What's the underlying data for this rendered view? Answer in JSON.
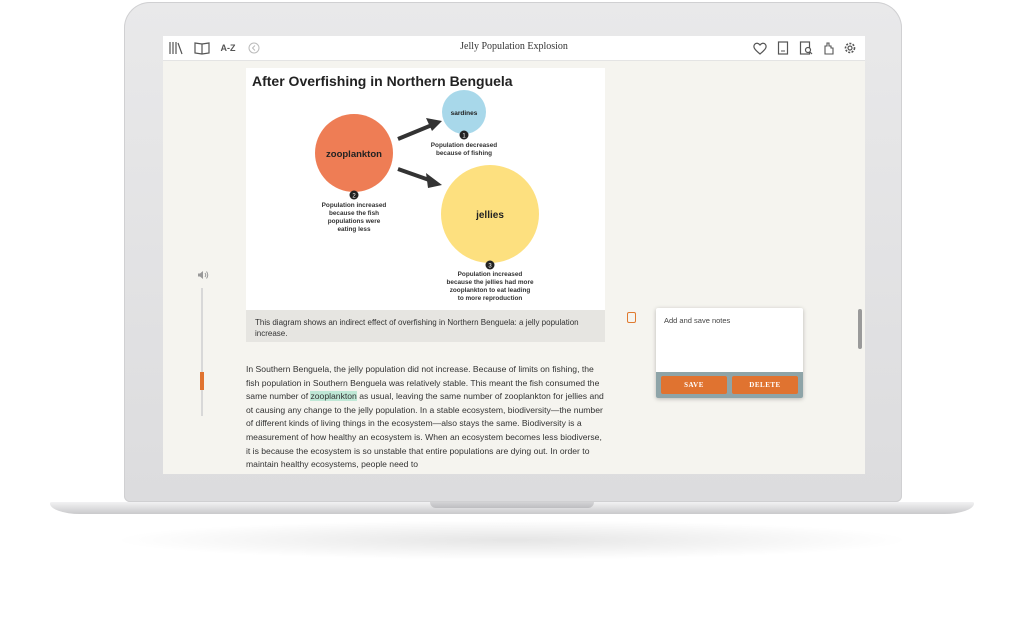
{
  "header": {
    "title": "Jelly Population Explosion",
    "icons_left": [
      "library-icon",
      "book-icon",
      "a-z-icon",
      "back-icon"
    ],
    "icons_right": [
      "heart-icon",
      "notebook-icon",
      "search-doc-icon",
      "hand-icon",
      "gear-icon"
    ],
    "az_label": "A-Z"
  },
  "diagram": {
    "title": "After Overfishing in Northern Benguela",
    "nodes": {
      "zooplankton": "zooplankton",
      "sardines": "sardines",
      "jellies": "jellies"
    },
    "steps": {
      "one": "1",
      "two": "2",
      "three": "3"
    },
    "notes": {
      "sardines": [
        "Population decreased",
        "because of fishing"
      ],
      "zooplankton": [
        "Population increased",
        "because the fish",
        "populations were",
        "eating less"
      ],
      "jellies": [
        "Population increased",
        "because the jellies had more",
        "zooplankton to eat leading",
        "to more reproduction"
      ]
    },
    "colors": {
      "zooplankton": "#ee7d55",
      "sardines": "#a8d8ea",
      "jellies": "#fde07f"
    }
  },
  "caption": "This diagram shows an indirect effect of overfishing in Northern Benguela: a jelly population increase.",
  "body": {
    "part1": "In Southern Benguela, the jelly population did not increase. Because of limits on fishing, the fish population in Southern Benguela was relatively stable. This meant the fish consumed the same number of ",
    "highlight": "zooplankton",
    "part2": " as usual, leaving the same number of zooplankton for jellies and ot causing any change to the jelly population. In a stable ecosystem, biodiversity—the number of different kinds of living things in the ecosystem—also stays the same. Biodiversity is a measurement of how healthy an ecosystem is. When an ecosystem becomes less biodiverse, it is because the ecosystem is so unstable that entire populations are dying out. In order to maintain healthy ecosystems, people need to"
  },
  "note": {
    "placeholder": "Add and save notes",
    "save_label": "SAVE",
    "delete_label": "DELETE"
  },
  "audio": {
    "volume_icon": "volume-icon"
  },
  "colors": {
    "accent": "#e07330"
  }
}
